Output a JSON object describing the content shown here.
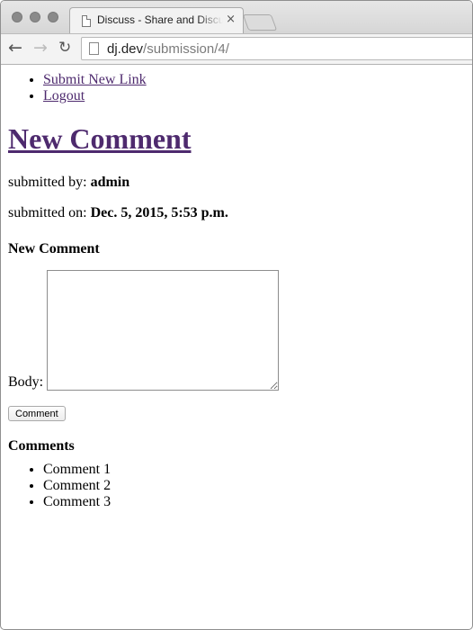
{
  "browser": {
    "tab_title": "Discuss - Share and Discuss",
    "tab_close": "×",
    "url_host": "dj.dev",
    "url_path": "/submission/4/",
    "back_icon": "←",
    "forward_icon": "→",
    "reload_icon": "↻"
  },
  "nav": {
    "items": [
      {
        "label": "Submit New Link"
      },
      {
        "label": "Logout"
      }
    ]
  },
  "page": {
    "title": "New Comment",
    "submitted_by_label": "submitted by:",
    "submitted_by_value": "admin",
    "submitted_on_label": "submitted on:",
    "submitted_on_value": "Dec. 5, 2015, 5:53 p.m."
  },
  "form": {
    "heading": "New Comment",
    "body_label": "Body:",
    "body_value": "",
    "submit_label": "Comment"
  },
  "comments": {
    "heading": "Comments",
    "items": [
      {
        "text": "Comment 1"
      },
      {
        "text": "Comment 2"
      },
      {
        "text": "Comment 3"
      }
    ]
  }
}
